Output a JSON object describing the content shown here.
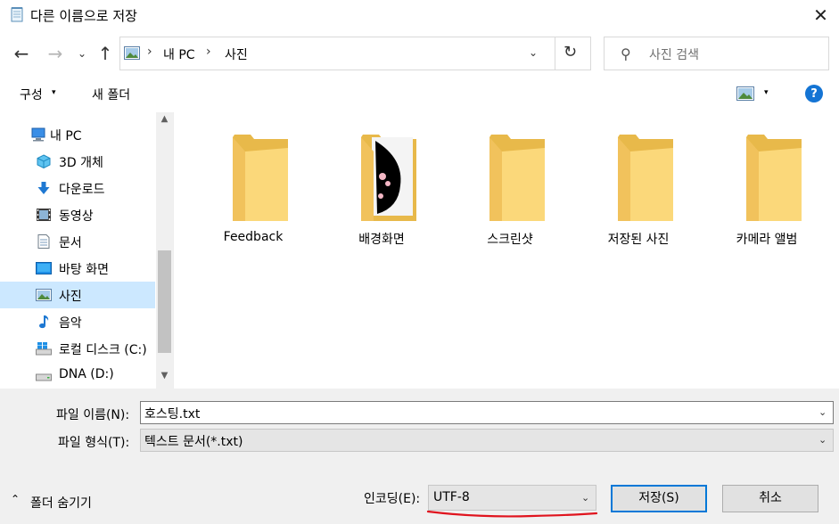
{
  "window": {
    "title": "다른 이름으로 저장",
    "close_glyph": "✕"
  },
  "navigation": {
    "back_glyph": "←",
    "forward_glyph": "→",
    "recent_glyph": "⌄",
    "up_glyph": "↑"
  },
  "address": {
    "separator": "›",
    "crumbs": [
      "내 PC",
      "사진"
    ],
    "dropdown_glyph": "⌄",
    "refresh_glyph": "↻"
  },
  "search": {
    "placeholder": "사진 검색",
    "icon_glyph": "⚲"
  },
  "toolbar": {
    "organize_label": "구성",
    "caret_glyph": "▾",
    "new_folder_label": "새 폴더",
    "help_label": "?"
  },
  "sidebar": {
    "items": [
      {
        "label": "내 PC",
        "icon": "computer-icon"
      },
      {
        "label": "3D 개체",
        "icon": "cube-icon"
      },
      {
        "label": "다운로드",
        "icon": "download-arrow-icon"
      },
      {
        "label": "동영상",
        "icon": "film-icon"
      },
      {
        "label": "문서",
        "icon": "document-icon"
      },
      {
        "label": "바탕 화면",
        "icon": "desktop-icon"
      },
      {
        "label": "사진",
        "icon": "picture-icon"
      },
      {
        "label": "음악",
        "icon": "music-note-icon"
      },
      {
        "label": "로컬 디스크 (C:)",
        "icon": "windows-drive-icon"
      },
      {
        "label": "DNA (D:)",
        "icon": "drive-icon"
      }
    ],
    "selected_index": 6,
    "scroll_up_glyph": "▲",
    "scroll_down_glyph": "▼"
  },
  "folders": [
    {
      "name": "Feedback",
      "thumbnail": false
    },
    {
      "name": "배경화면",
      "thumbnail": true
    },
    {
      "name": "스크린샷",
      "thumbnail": false
    },
    {
      "name": "저장된 사진",
      "thumbnail": false
    },
    {
      "name": "카메라 앨범",
      "thumbnail": false
    }
  ],
  "form": {
    "filename_label": "파일 이름(N):",
    "filename_value": "호스팅.txt",
    "filetype_label": "파일 형식(T):",
    "filetype_value": "텍스트 문서(*.txt)",
    "dropdown_glyph": "⌄",
    "hide_folders_glyph": "⌃",
    "hide_folders_label": "폴더 숨기기",
    "encoding_label": "인코딩(E):",
    "encoding_value": "UTF-8",
    "save_label": "저장(S)",
    "cancel_label": "취소"
  },
  "colors": {
    "accent": "#0078d7",
    "selection": "#cce8ff",
    "folder": "#f8d775",
    "annotation": "#e0141e"
  }
}
